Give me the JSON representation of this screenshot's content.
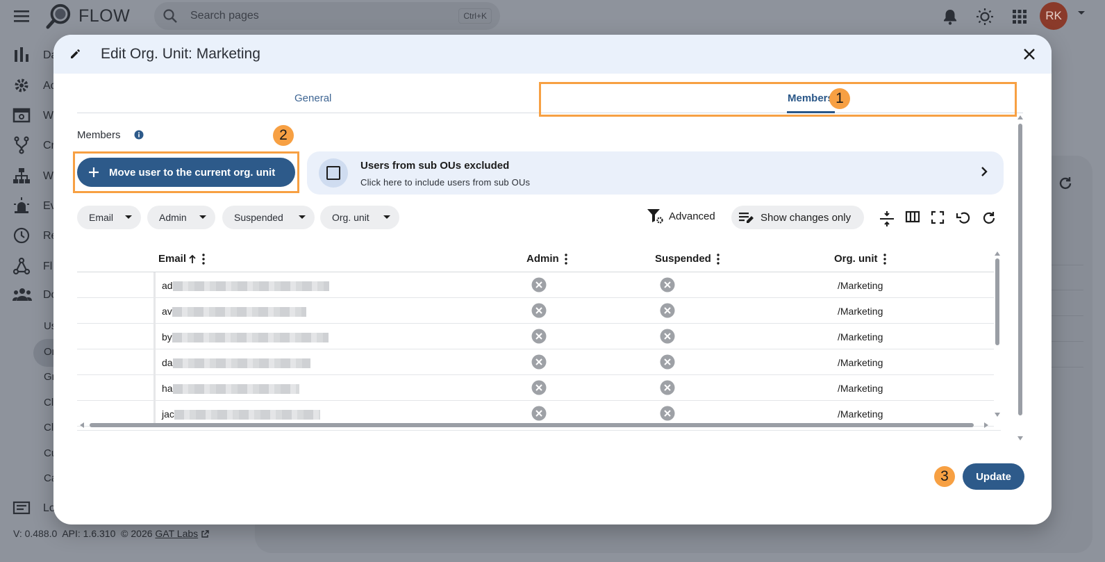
{
  "app": {
    "name": "FLOW"
  },
  "search": {
    "placeholder": "Search pages",
    "shortcut": "Ctrl+K"
  },
  "user": {
    "initials": "RK"
  },
  "sidebar": {
    "items": [
      {
        "label": "Da",
        "icon": "bar-chart-icon"
      },
      {
        "label": "Ac",
        "icon": "gear-icon"
      },
      {
        "label": "W",
        "icon": "window-icon"
      },
      {
        "label": "Cr",
        "icon": "fork-icon"
      },
      {
        "label": "W",
        "icon": "hierarchy-icon"
      },
      {
        "label": "Ev",
        "icon": "alarm-icon"
      },
      {
        "label": "Re",
        "icon": "clock-icon"
      },
      {
        "label": "Fl",
        "icon": "flow-icon"
      },
      {
        "label": "Do",
        "icon": "people-icon"
      }
    ],
    "sub_items": [
      "Us",
      "Or",
      "Gr",
      "Cl",
      "Cl",
      "Cu",
      "Ca"
    ],
    "logs": {
      "label": "Lo",
      "icon": "list-icon"
    }
  },
  "footer": {
    "version": "V: 0.488.0",
    "api": "API: 1.6.310",
    "copyright": "© 2026",
    "company": "GAT Labs"
  },
  "modal": {
    "title": "Edit Org. Unit: Marketing",
    "tabs": [
      {
        "label": "General",
        "active": false
      },
      {
        "label": "Members",
        "active": true
      }
    ],
    "members_label": "Members",
    "move_button": "Move user to the current org. unit",
    "subou": {
      "title": "Users from sub OUs excluded",
      "subtitle": "Click here to include users from sub OUs",
      "checked": false
    },
    "filters": [
      "Email",
      "Admin",
      "Suspended",
      "Org. unit"
    ],
    "toolbar": {
      "advanced": "Advanced",
      "show_changes": "Show changes only"
    },
    "columns": {
      "email": "Email",
      "admin": "Admin",
      "suspended": "Suspended",
      "org_unit": "Org. unit"
    },
    "sort": {
      "column": "Email",
      "direction": "ascending"
    },
    "rows": [
      {
        "email_prefix": "ad",
        "admin": false,
        "suspended": false,
        "org_unit": "/Marketing"
      },
      {
        "email_prefix": "av",
        "admin": false,
        "suspended": false,
        "org_unit": "/Marketing"
      },
      {
        "email_prefix": "by",
        "admin": false,
        "suspended": false,
        "org_unit": "/Marketing"
      },
      {
        "email_prefix": "da",
        "admin": false,
        "suspended": false,
        "org_unit": "/Marketing"
      },
      {
        "email_prefix": "ha",
        "admin": false,
        "suspended": false,
        "org_unit": "/Marketing"
      },
      {
        "email_prefix": "jac",
        "admin": false,
        "suspended": false,
        "org_unit": "/Marketing"
      }
    ],
    "update_button": "Update"
  },
  "annotations": [
    "1",
    "2",
    "3"
  ],
  "colors": {
    "primary": "#2d5a8a",
    "highlight": "#f7a043",
    "overlay": "#8e939c"
  }
}
